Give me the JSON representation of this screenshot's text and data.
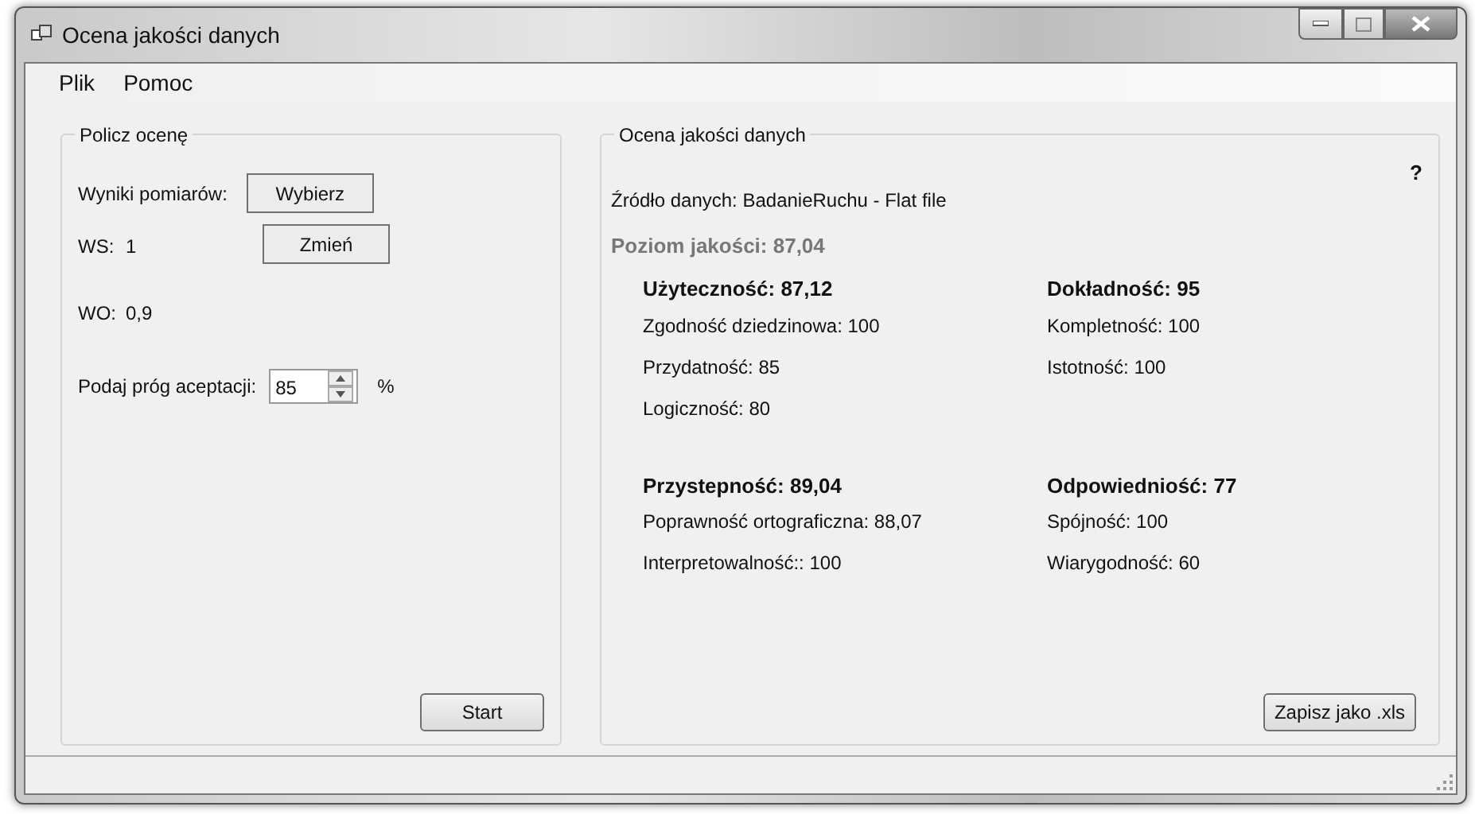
{
  "window": {
    "title": "Ocena jakości danych"
  },
  "menu": [
    {
      "label": "Plik"
    },
    {
      "label": "Pomoc"
    }
  ],
  "left_group": {
    "title": "Policz ocenę",
    "measurements_label": "Wyniki pomiarów:",
    "choose_button": "Wybierz",
    "ws_label": "WS:",
    "ws_value": "1",
    "change_button": "Zmień",
    "wo_label": "WO:",
    "wo_value": "0,9",
    "threshold_label": "Podaj próg aceptacji:",
    "threshold_value": "85",
    "percent": "%",
    "start_button": "Start"
  },
  "right_group": {
    "title": "Ocena jakości danych",
    "help": "?",
    "source": "Źródło danych: BadanieRuchu - Flat file",
    "quality_level": "Poziom jakości: 87,04",
    "categories": [
      {
        "heading": "Użyteczność: 87,12",
        "items": [
          "Zgodność dziedzinowa: 100",
          "Przydatność: 85",
          "Logiczność: 80"
        ]
      },
      {
        "heading": "Dokładność: 95",
        "items": [
          "Kompletność: 100",
          "Istotność: 100"
        ]
      },
      {
        "heading": "Przystepność: 89,04",
        "items": [
          "Poprawność ortograficzna: 88,07",
          "Interpretowalność:: 100"
        ]
      },
      {
        "heading": "Odpowiedniość: 77",
        "items": [
          "Spójność: 100",
          "Wiarygodność: 60"
        ]
      }
    ],
    "save_button": "Zapisz jako .xls"
  }
}
